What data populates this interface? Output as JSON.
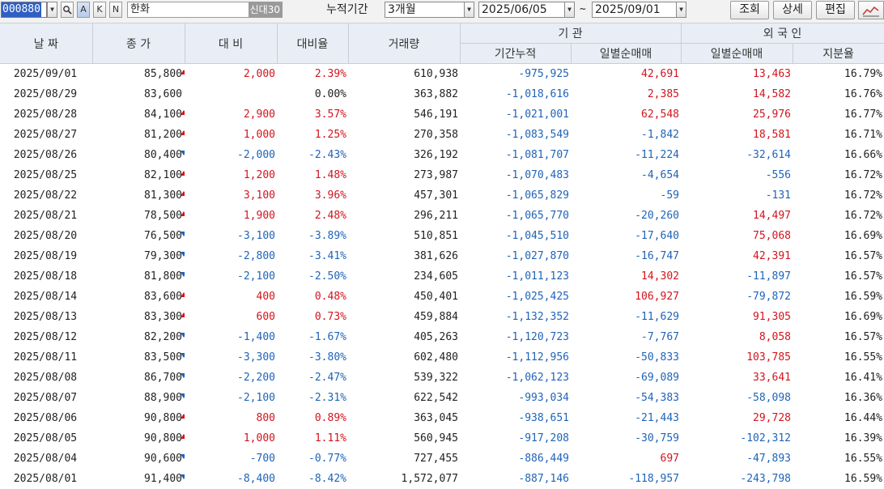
{
  "toolbar": {
    "code": "000880",
    "name": "한화",
    "name_tags": "신대30",
    "btn_search_icon": "magnifier-icon",
    "btn_a": "A",
    "btn_k": "K",
    "btn_n": "N",
    "period_label": "누적기간",
    "period_value": "3개월",
    "date_from": "2025/06/05",
    "tilde": "~",
    "date_to": "2025/09/01",
    "query_btn": "조회",
    "detail_btn": "상세",
    "edit_btn": "편집",
    "chart_icon": "chart-icon"
  },
  "headers": {
    "date": "날 짜",
    "close": "종 가",
    "change": "대 비",
    "rate": "대비율",
    "volume": "거래량",
    "inst": "기 관",
    "inst_cum": "기간누적",
    "inst_daily": "일별순매매",
    "foreign": "외 국 인",
    "foreign_daily": "일별순매매",
    "foreign_ratio": "지분율"
  },
  "rows": [
    {
      "date": "2025/09/01",
      "close": "85,800",
      "dir": "up",
      "change": "2,000",
      "rate": "2.39%",
      "volume": "610,938",
      "inst_cum": "-975,925",
      "inst_daily": "42,691",
      "frg_daily": "13,463",
      "ratio": "16.79%"
    },
    {
      "date": "2025/08/29",
      "close": "83,600",
      "dir": "flat",
      "change": "",
      "rate": "0.00%",
      "volume": "363,882",
      "inst_cum": "-1,018,616",
      "inst_daily": "2,385",
      "frg_daily": "14,582",
      "ratio": "16.76%"
    },
    {
      "date": "2025/08/28",
      "close": "84,100",
      "dir": "up",
      "change": "2,900",
      "rate": "3.57%",
      "volume": "546,191",
      "inst_cum": "-1,021,001",
      "inst_daily": "62,548",
      "frg_daily": "25,976",
      "ratio": "16.77%"
    },
    {
      "date": "2025/08/27",
      "close": "81,200",
      "dir": "up",
      "change": "1,000",
      "rate": "1.25%",
      "volume": "270,358",
      "inst_cum": "-1,083,549",
      "inst_daily": "-1,842",
      "frg_daily": "18,581",
      "ratio": "16.71%"
    },
    {
      "date": "2025/08/26",
      "close": "80,400",
      "dir": "down",
      "change": "-2,000",
      "rate": "-2.43%",
      "volume": "326,192",
      "inst_cum": "-1,081,707",
      "inst_daily": "-11,224",
      "frg_daily": "-32,614",
      "ratio": "16.66%"
    },
    {
      "date": "2025/08/25",
      "close": "82,100",
      "dir": "up",
      "change": "1,200",
      "rate": "1.48%",
      "volume": "273,987",
      "inst_cum": "-1,070,483",
      "inst_daily": "-4,654",
      "frg_daily": "-556",
      "ratio": "16.72%"
    },
    {
      "date": "2025/08/22",
      "close": "81,300",
      "dir": "up",
      "change": "3,100",
      "rate": "3.96%",
      "volume": "457,301",
      "inst_cum": "-1,065,829",
      "inst_daily": "-59",
      "frg_daily": "-131",
      "ratio": "16.72%"
    },
    {
      "date": "2025/08/21",
      "close": "78,500",
      "dir": "up",
      "change": "1,900",
      "rate": "2.48%",
      "volume": "296,211",
      "inst_cum": "-1,065,770",
      "inst_daily": "-20,260",
      "frg_daily": "14,497",
      "ratio": "16.72%"
    },
    {
      "date": "2025/08/20",
      "close": "76,500",
      "dir": "down",
      "change": "-3,100",
      "rate": "-3.89%",
      "volume": "510,851",
      "inst_cum": "-1,045,510",
      "inst_daily": "-17,640",
      "frg_daily": "75,068",
      "ratio": "16.69%"
    },
    {
      "date": "2025/08/19",
      "close": "79,300",
      "dir": "down",
      "change": "-2,800",
      "rate": "-3.41%",
      "volume": "381,626",
      "inst_cum": "-1,027,870",
      "inst_daily": "-16,747",
      "frg_daily": "42,391",
      "ratio": "16.57%"
    },
    {
      "date": "2025/08/18",
      "close": "81,800",
      "dir": "down",
      "change": "-2,100",
      "rate": "-2.50%",
      "volume": "234,605",
      "inst_cum": "-1,011,123",
      "inst_daily": "14,302",
      "frg_daily": "-11,897",
      "ratio": "16.57%"
    },
    {
      "date": "2025/08/14",
      "close": "83,600",
      "dir": "up",
      "change": "400",
      "rate": "0.48%",
      "volume": "450,401",
      "inst_cum": "-1,025,425",
      "inst_daily": "106,927",
      "frg_daily": "-79,872",
      "ratio": "16.59%"
    },
    {
      "date": "2025/08/13",
      "close": "83,300",
      "dir": "up",
      "change": "600",
      "rate": "0.73%",
      "volume": "459,884",
      "inst_cum": "-1,132,352",
      "inst_daily": "-11,629",
      "frg_daily": "91,305",
      "ratio": "16.69%"
    },
    {
      "date": "2025/08/12",
      "close": "82,200",
      "dir": "down",
      "change": "-1,400",
      "rate": "-1.67%",
      "volume": "405,263",
      "inst_cum": "-1,120,723",
      "inst_daily": "-7,767",
      "frg_daily": "8,058",
      "ratio": "16.57%"
    },
    {
      "date": "2025/08/11",
      "close": "83,500",
      "dir": "down",
      "change": "-3,300",
      "rate": "-3.80%",
      "volume": "602,480",
      "inst_cum": "-1,112,956",
      "inst_daily": "-50,833",
      "frg_daily": "103,785",
      "ratio": "16.55%"
    },
    {
      "date": "2025/08/08",
      "close": "86,700",
      "dir": "down",
      "change": "-2,200",
      "rate": "-2.47%",
      "volume": "539,322",
      "inst_cum": "-1,062,123",
      "inst_daily": "-69,089",
      "frg_daily": "33,641",
      "ratio": "16.41%"
    },
    {
      "date": "2025/08/07",
      "close": "88,900",
      "dir": "down",
      "change": "-2,100",
      "rate": "-2.31%",
      "volume": "622,542",
      "inst_cum": "-993,034",
      "inst_daily": "-54,383",
      "frg_daily": "-58,098",
      "ratio": "16.36%"
    },
    {
      "date": "2025/08/06",
      "close": "90,800",
      "dir": "up",
      "change": "800",
      "rate": "0.89%",
      "volume": "363,045",
      "inst_cum": "-938,651",
      "inst_daily": "-21,443",
      "frg_daily": "29,728",
      "ratio": "16.44%"
    },
    {
      "date": "2025/08/05",
      "close": "90,800",
      "dir": "up",
      "change": "1,000",
      "rate": "1.11%",
      "volume": "560,945",
      "inst_cum": "-917,208",
      "inst_daily": "-30,759",
      "frg_daily": "-102,312",
      "ratio": "16.39%"
    },
    {
      "date": "2025/08/04",
      "close": "90,600",
      "dir": "down",
      "change": "-700",
      "rate": "-0.77%",
      "volume": "727,455",
      "inst_cum": "-886,449",
      "inst_daily": "697",
      "frg_daily": "-47,893",
      "ratio": "16.55%"
    },
    {
      "date": "2025/08/01",
      "close": "91,400",
      "dir": "down",
      "change": "-8,400",
      "rate": "-8.42%",
      "volume": "1,572,077",
      "inst_cum": "-887,146",
      "inst_daily": "-118,957",
      "frg_daily": "-243,798",
      "ratio": "16.59%"
    }
  ]
}
